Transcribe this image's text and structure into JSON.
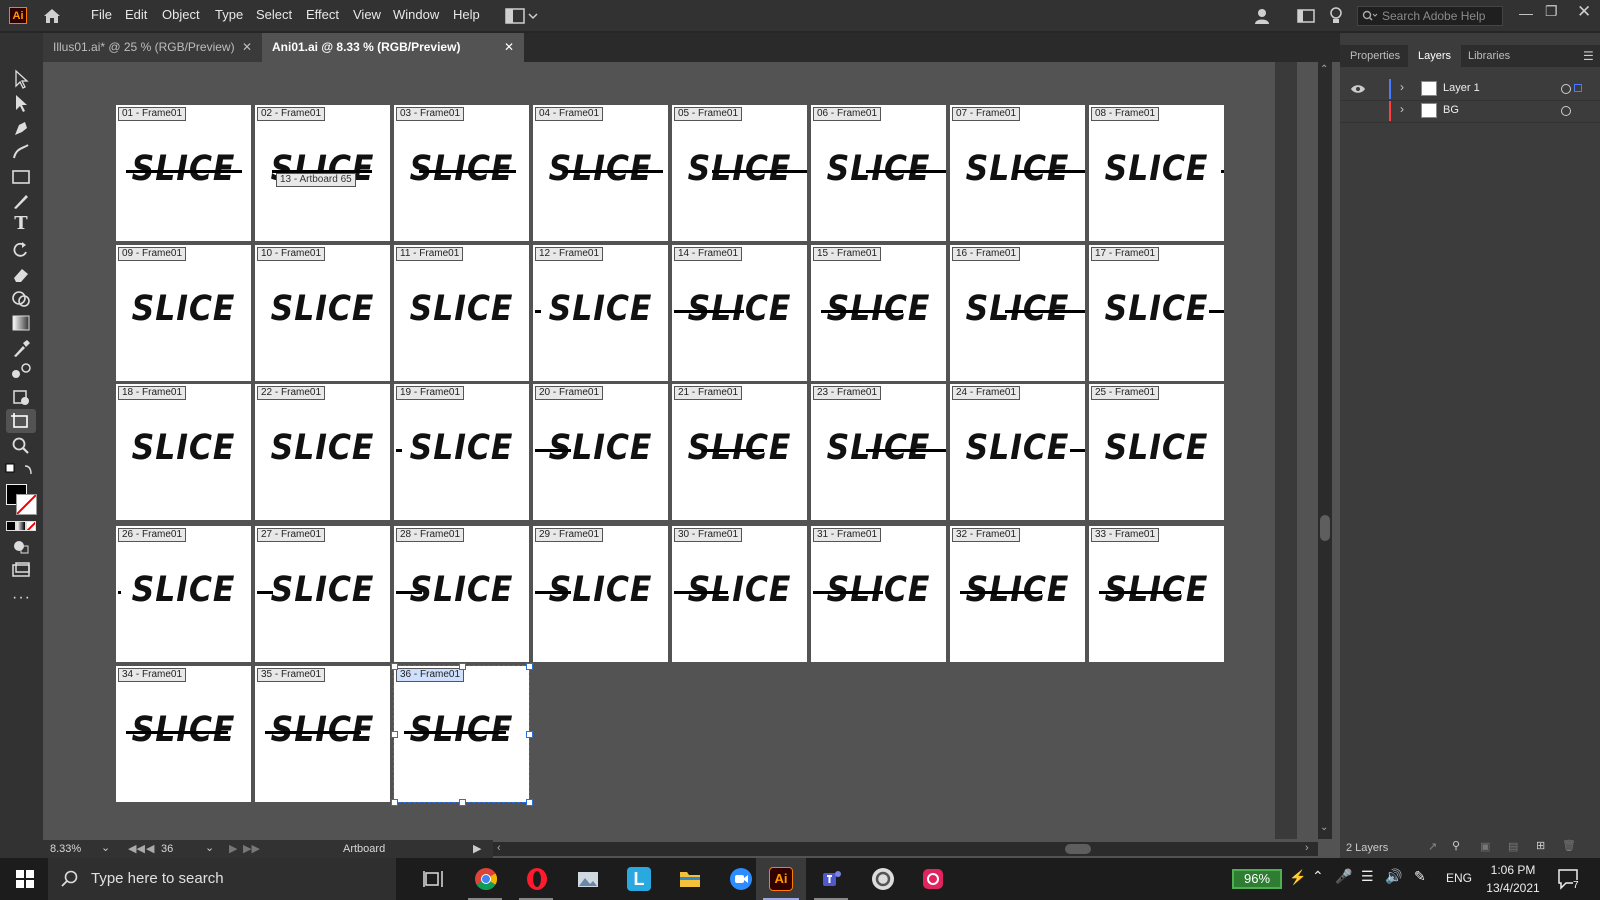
{
  "app": {
    "name": "Adobe Illustrator",
    "logo": "Ai"
  },
  "menu": [
    "File",
    "Edit",
    "Object",
    "Type",
    "Select",
    "Effect",
    "View",
    "Window",
    "Help"
  ],
  "search_help": {
    "placeholder": "Search Adobe Help"
  },
  "tabs": [
    {
      "label": "Illus01.ai* @ 25 % (RGB/Preview)",
      "active": false
    },
    {
      "label": "Ani01.ai @ 8.33 % (RGB/Preview)",
      "active": true
    }
  ],
  "artboards": [
    {
      "label": "01 - Frame01",
      "word": "SLICE"
    },
    {
      "label": "02 - Frame01",
      "word": "SLICE"
    },
    {
      "label": "03 - Frame01",
      "word": "SLICE"
    },
    {
      "label": "04 - Frame01",
      "word": "SLICE"
    },
    {
      "label": "05 - Frame01",
      "word": "SLICE"
    },
    {
      "label": "06 - Frame01",
      "word": "SLICE"
    },
    {
      "label": "07 - Frame01",
      "word": "SLICE"
    },
    {
      "label": "08 - Frame01",
      "word": "SLICE"
    },
    {
      "label": "09 - Frame01",
      "word": "SLICE"
    },
    {
      "label": "10 - Frame01",
      "word": "SLICE"
    },
    {
      "label": "11 - Frame01",
      "word": "SLICE"
    },
    {
      "label": "12 - Frame01",
      "word": "SLICE"
    },
    {
      "label": "14 - Frame01",
      "word": "SLICE"
    },
    {
      "label": "15 - Frame01",
      "word": "SLICE"
    },
    {
      "label": "16 - Frame01",
      "word": "SLICE"
    },
    {
      "label": "17 - Frame01",
      "word": "SLICE"
    },
    {
      "label": "18 - Frame01",
      "word": "SLICE"
    },
    {
      "label": "22 - Frame01",
      "word": "SLICE"
    },
    {
      "label": "19 - Frame01",
      "word": "SLICE"
    },
    {
      "label": "20 - Frame01",
      "word": "SLICE"
    },
    {
      "label": "21 - Frame01",
      "word": "SLICE"
    },
    {
      "label": "23 - Frame01",
      "word": "SLICE"
    },
    {
      "label": "24 - Frame01",
      "word": "SLICE"
    },
    {
      "label": "25 - Frame01",
      "word": "SLICE"
    },
    {
      "label": "26 - Frame01",
      "word": "SLICE"
    },
    {
      "label": "27 - Frame01",
      "word": "SLICE"
    },
    {
      "label": "28 - Frame01",
      "word": "SLICE"
    },
    {
      "label": "29 - Frame01",
      "word": "SLICE"
    },
    {
      "label": "30 - Frame01",
      "word": "SLICE"
    },
    {
      "label": "31 - Frame01",
      "word": "SLICE"
    },
    {
      "label": "32 - Frame01",
      "word": "SLICE"
    },
    {
      "label": "33 - Frame01",
      "word": "SLICE"
    },
    {
      "label": "34 - Frame01",
      "word": "SLICE"
    },
    {
      "label": "35 - Frame01",
      "word": "SLICE"
    },
    {
      "label": "36 - Frame01",
      "word": "SLICE"
    }
  ],
  "selected_artboard": "36 - Frame01",
  "tooltip": "13 - Artboard 65",
  "status": {
    "zoom": "8.33%",
    "artboard_number": "36",
    "tool": "Artboard"
  },
  "panel": {
    "tabs": [
      "Properties",
      "Layers",
      "Libraries"
    ],
    "active_tab": "Layers",
    "layers": [
      {
        "name": "Layer 1",
        "color": "#4a7bff",
        "visible": true
      },
      {
        "name": "BG",
        "color": "#ff4040",
        "visible": false
      }
    ],
    "footer": "2 Layers"
  },
  "taskbar": {
    "search_placeholder": "Type here to search",
    "battery": "96%",
    "language": "ENG",
    "time": "1:06 PM",
    "date": "13/4/2021",
    "notifications": "7"
  }
}
